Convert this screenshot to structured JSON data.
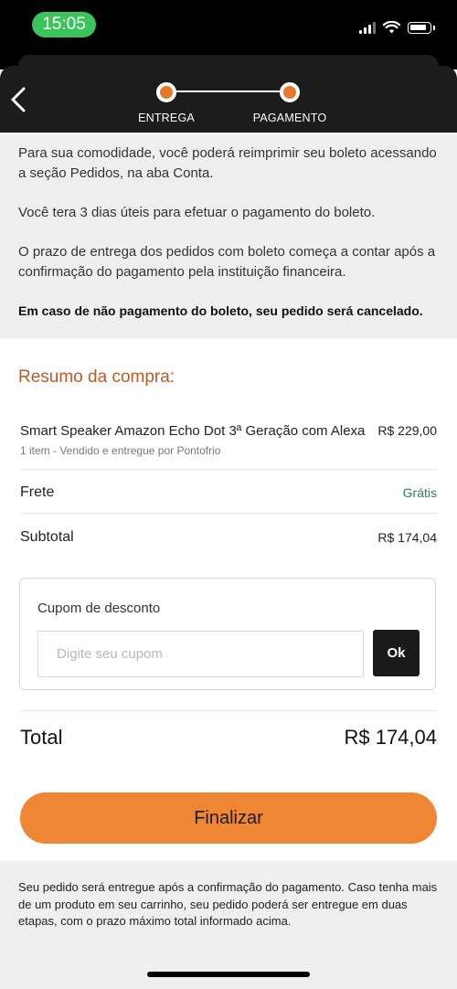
{
  "status_bar": {
    "time": "15:05"
  },
  "header": {
    "steps": [
      {
        "label": "ENTREGA"
      },
      {
        "label": "PAGAMENTO"
      }
    ]
  },
  "info": {
    "paragraphs": [
      "Para sua comodidade, você poderá reimprimir seu boleto acessando a seção Pedidos, na aba Conta.",
      "Você tera 3 dias úteis para efetuar o pagamento do boleto.",
      "O prazo de entrega dos pedidos com boleto começa a contar após a confirmação do pagamento pela instituição financeira."
    ],
    "warning": "Em caso de não pagamento do boleto, seu pedido será cancelado."
  },
  "summary": {
    "title": "Resumo da compra:",
    "product": {
      "name": "Smart Speaker Amazon Echo Dot 3ª Geração com Alexa",
      "price": "R$ 229,00",
      "subtitle": "1 item - Vendido e entregue por Pontofrio"
    },
    "shipping": {
      "label": "Frete",
      "value": "Grátis"
    },
    "subtotal": {
      "label": "Subtotal",
      "value": "R$ 174,04"
    },
    "coupon": {
      "label": "Cupom de desconto",
      "placeholder": "Digite seu cupom",
      "value": "",
      "button_label": "Ok"
    },
    "total": {
      "label": "Total",
      "value": "R$ 174,04"
    },
    "finalize_label": "Finalizar"
  },
  "footer": {
    "note": "Seu pedido será entregue após a confirmação do pagamento. Caso tenha mais de um produto em seu carrinho, seu pedido poderá ser entregue em duas etapas, com o prazo máximo total informado acima."
  },
  "colors": {
    "accent_orange": "#ef8633",
    "title_orange": "#b85c28",
    "free_green": "#2e7d5b",
    "time_pill_green": "#3ac45b"
  }
}
